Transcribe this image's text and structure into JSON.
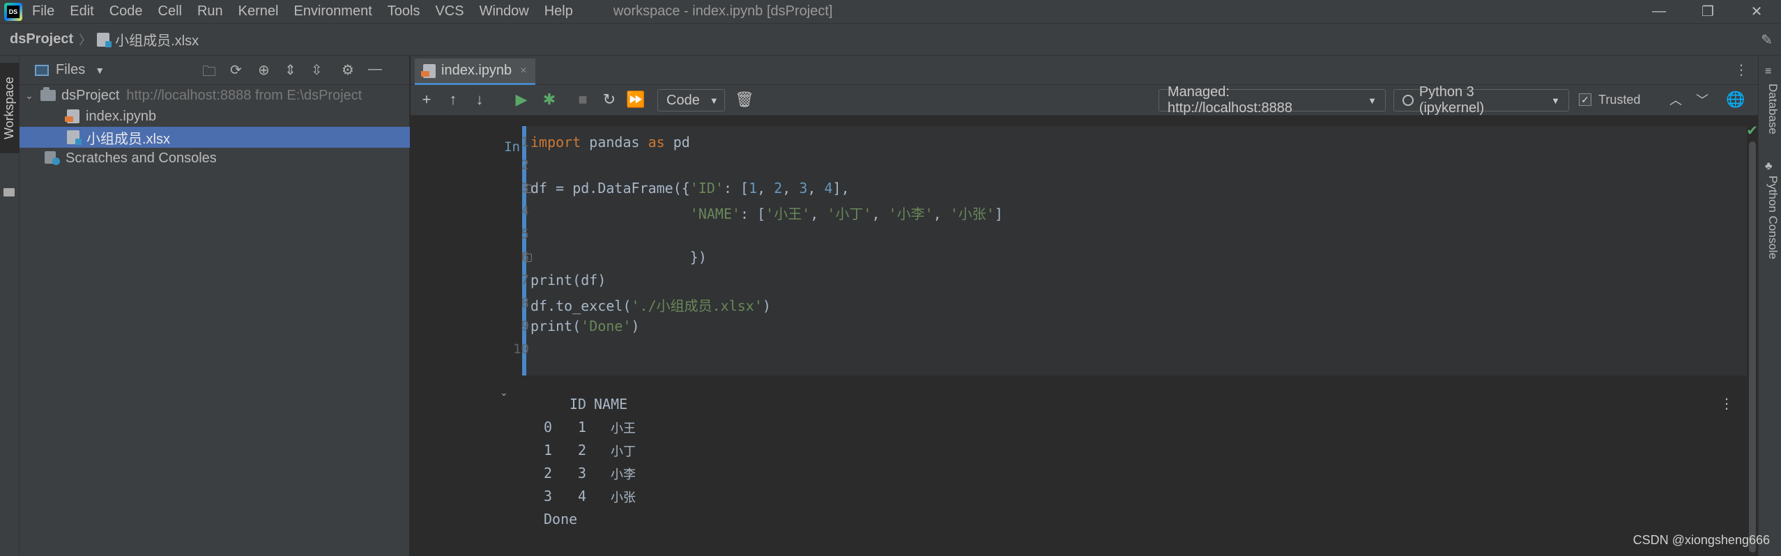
{
  "menu": {
    "logo_text": "DS",
    "items": [
      "File",
      "Edit",
      "Code",
      "Cell",
      "Run",
      "Kernel",
      "Environment",
      "Tools",
      "VCS",
      "Window",
      "Help"
    ],
    "window_title": "workspace - index.ipynb [dsProject]",
    "controls": {
      "minimize": "—",
      "restore": "❐",
      "close": "✕"
    }
  },
  "breadcrumb": {
    "project": "dsProject",
    "separator": "〉",
    "file": "小组成员.xlsx"
  },
  "left_strip": {
    "tab_label": "Workspace"
  },
  "project_panel": {
    "title": "Files",
    "tree": {
      "root_name": "dsProject",
      "root_hint": "http://localhost:8888 from E:\\dsProject",
      "files": [
        "index.ipynb",
        "小组成员.xlsx"
      ],
      "scratches": "Scratches and Consoles"
    }
  },
  "editor": {
    "tab": {
      "label": "index.ipynb",
      "close": "×"
    },
    "toolbar": {
      "cell_type": "Code",
      "server": "Managed: http://localhost:8888",
      "kernel": "Python 3 (ipykernel)",
      "trusted_label": "Trusted"
    },
    "cell": {
      "execution_count": "In  2",
      "line_numbers": [
        "1",
        "2",
        "3",
        "4",
        "5",
        "6",
        "7",
        "8",
        "9",
        "10"
      ],
      "code": [
        "import pandas as pd",
        "",
        "df = pd.DataFrame({'ID': [1, 2, 3, 4],",
        "                   'NAME': ['小王', '小丁', '小李', '小张']",
        "",
        "                   })",
        "print(df)",
        "df.to_excel('./小组成员.xlsx')",
        "print('Done')",
        ""
      ]
    },
    "output": {
      "header": [
        "ID",
        "NAME"
      ],
      "rows": [
        {
          "index": "0",
          "id": "1",
          "name": "小王"
        },
        {
          "index": "1",
          "id": "2",
          "name": "小丁"
        },
        {
          "index": "2",
          "id": "3",
          "name": "小李"
        },
        {
          "index": "3",
          "id": "4",
          "name": "小张"
        }
      ],
      "done": "Done"
    }
  },
  "right_strip": {
    "database": "Database",
    "python_console": "Python Console"
  },
  "watermark": "CSDN @xiongsheng666",
  "colors": {
    "accent": "#4a88c7",
    "selection": "#4b6eaf",
    "keyword": "#cc7832",
    "string": "#6a8759",
    "number": "#6897bb",
    "success": "#59a869"
  }
}
